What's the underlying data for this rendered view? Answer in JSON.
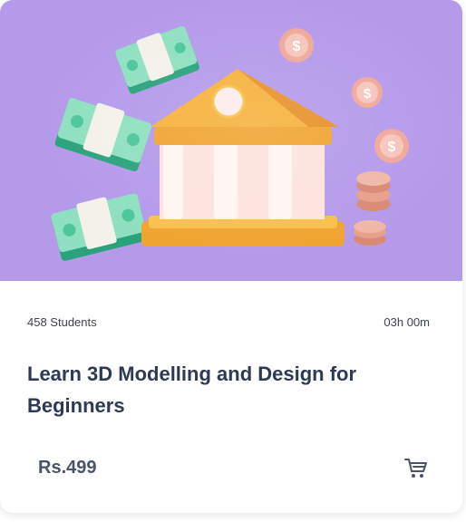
{
  "course": {
    "students": "458 Students",
    "duration": "03h 00m",
    "title": "Learn 3D Modelling and Design for Beginners",
    "price": "Rs.499"
  },
  "icons": {
    "hero": "bank-with-money-illustration",
    "cart": "cart-icon"
  },
  "colors": {
    "hero_background": "#b59aea",
    "title": "#2d3a55",
    "text": "#3b4256",
    "price": "#4a5468"
  }
}
